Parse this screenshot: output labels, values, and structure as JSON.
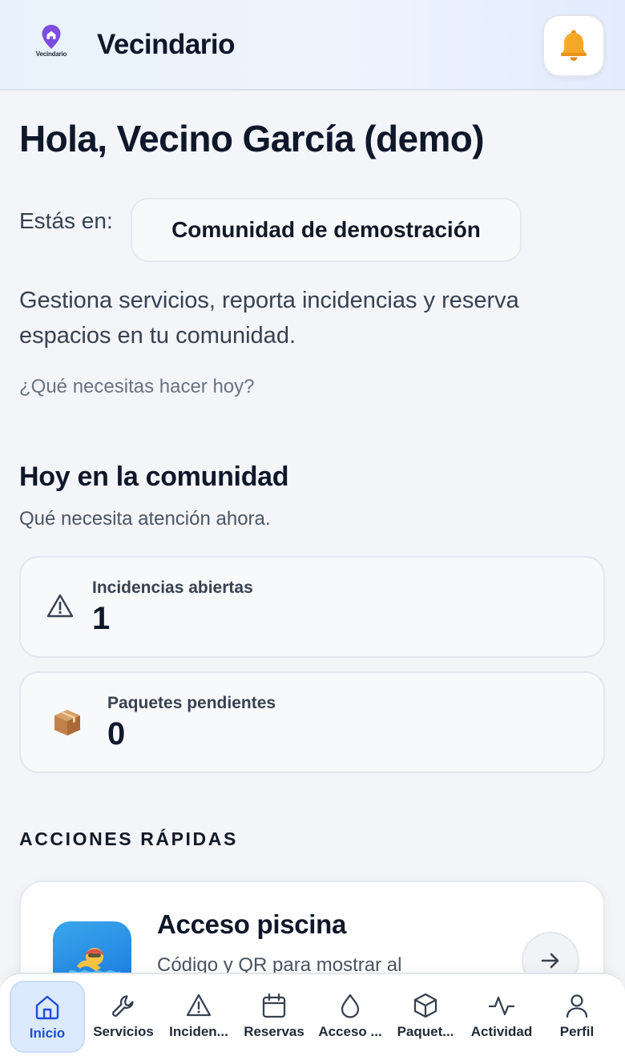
{
  "header": {
    "logo_text": "Vecindario",
    "app_title": "Vecindario"
  },
  "greeting": "Hola, Vecino García (demo)",
  "location": {
    "label": "Estás en:",
    "community": "Comunidad de demostración"
  },
  "intro_text": "Gestiona servicios, reporta incidencias y reserva espacios en tu comunidad.",
  "question": "¿Qué necesitas hacer hoy?",
  "today": {
    "title": "Hoy en la comunidad",
    "subtitle": "Qué necesita atención ahora.",
    "stats": [
      {
        "label": "Incidencias abiertas",
        "value": "1",
        "icon": "warning-icon"
      },
      {
        "label": "Paquetes pendientes",
        "value": "0",
        "icon": "package-icon"
      }
    ]
  },
  "quick_actions": {
    "title": "ACCIONES RÁPIDAS",
    "items": [
      {
        "title": "Acceso piscina",
        "description": "Código y QR para mostrar al",
        "icon": "swimmer-icon"
      }
    ]
  },
  "nav": {
    "items": [
      {
        "label": "Inicio",
        "icon": "home-icon",
        "active": true
      },
      {
        "label": "Servicios",
        "icon": "wrench-icon"
      },
      {
        "label": "Inciden...",
        "icon": "warning-icon"
      },
      {
        "label": "Reservas",
        "icon": "calendar-icon"
      },
      {
        "label": "Acceso ...",
        "icon": "drop-icon"
      },
      {
        "label": "Paquet...",
        "icon": "box-icon"
      },
      {
        "label": "Actividad",
        "icon": "activity-icon"
      },
      {
        "label": "Perfil",
        "icon": "user-icon"
      }
    ]
  },
  "colors": {
    "accent": "#2563eb",
    "active_nav_bg": "#dbeafe",
    "logo_purple": "#7c4de0"
  }
}
